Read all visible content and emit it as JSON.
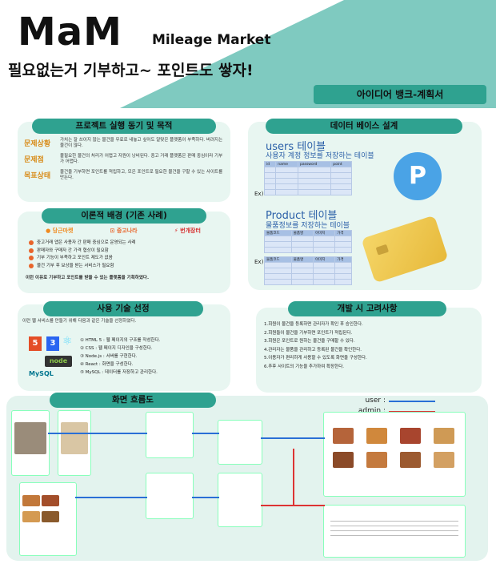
{
  "header": {
    "logo": "MaM",
    "logo_sub": "Mileage Market",
    "slogan": "필요없는거 기부하고~ 포인트도 쌓자!",
    "doc_title": "아이디어 뱅크-계획서"
  },
  "sections": {
    "purpose": {
      "title": "프로젝트 실행 동기 및 목적",
      "rows": [
        {
          "label": "문제상황",
          "text": "가치는 잘 쓰이지 않는 물건을 무료로 내놓고 싶어도 알맞은 플랫폼이 부족하다. 버려지는 물건이 많다."
        },
        {
          "label": "문제점",
          "text": "불필요한 물건의 처리가 어렵고 자원이 낭비된다. 중고 거래 플랫폼은 판매 중심이라 기부가 어렵다."
        },
        {
          "label": "목표상태",
          "text": "물건을 기부하면 포인트를 적립하고, 모은 포인트로 필요한 물건을 구할 수 있는 사이트를 만든다."
        }
      ]
    },
    "prior": {
      "title": "이론적 배경 (기존 사례)",
      "brands": [
        "당근마켓",
        "중고나라",
        "번개장터"
      ],
      "bullets": [
        "중고거래 앱은 사용자 간 판매 중심으로 운영되는 사례",
        "판매자와 구매자 간 가격 협상이 필요함",
        "기부 기능이 부족하고 포인트 제도가 없음",
        "물건 기부 후 보상을 받는 서비스가 필요함"
      ],
      "summary": "이런 이유로 기부하고 포인트를 받을 수 있는 플랫폼을 기획하였다."
    },
    "tech": {
      "title": "사용 기술 선정",
      "intro": "이런 웹 서비스를 만들기 위해 다음과 같은 기술을 선정하였다.",
      "items": [
        "① HTML 5 : 웹 페이지의 구조를 작성한다.",
        "② CSS : 웹 페이지 디자인을 구성한다.",
        "③ Node.js : 서버를 구현한다.",
        "④ React : 화면을 구성한다.",
        "⑤ MySQL : 데이터를 저장하고 관리한다."
      ],
      "logos": [
        "HTML5",
        "CSS3",
        "React",
        "node",
        "MySQL"
      ]
    },
    "database": {
      "title": "데이터 베이스 설계",
      "users_title": "users 테이블",
      "users_sub": "사용자 계정 정보를 저장하는 테이블",
      "product_title": "Product 테이블",
      "product_sub": "물품정보를 저장하는 테이블",
      "ex": "Ex)",
      "users_cols": [
        "id",
        "name",
        "password",
        "point"
      ],
      "product_cols": [
        "물품코드",
        "물품명",
        "이미지",
        "가격"
      ]
    },
    "considerations": {
      "title": "개발 시 고려사항",
      "items": [
        "1.회원이 물건을 등록하면 관리자가 확인 후 승인한다.",
        "2.회원들이 물건을 기부하면 포인트가 적립된다.",
        "3.회원은 포인트로 원하는 물건을 구매할 수 있다.",
        "4.관리자는 물품을 관리하고 등록된 물건을 확인한다.",
        "5.이용자가 편리하게 사용할 수 있도록 화면을 구성한다.",
        "6.추후 사이트의 기능을 추가하여 확장한다."
      ]
    },
    "flow": {
      "title": "화면 흐름도",
      "legend_user": "user :",
      "legend_admin": "admin :",
      "colors": {
        "user": "#2a6fd6",
        "admin": "#d33"
      }
    }
  }
}
